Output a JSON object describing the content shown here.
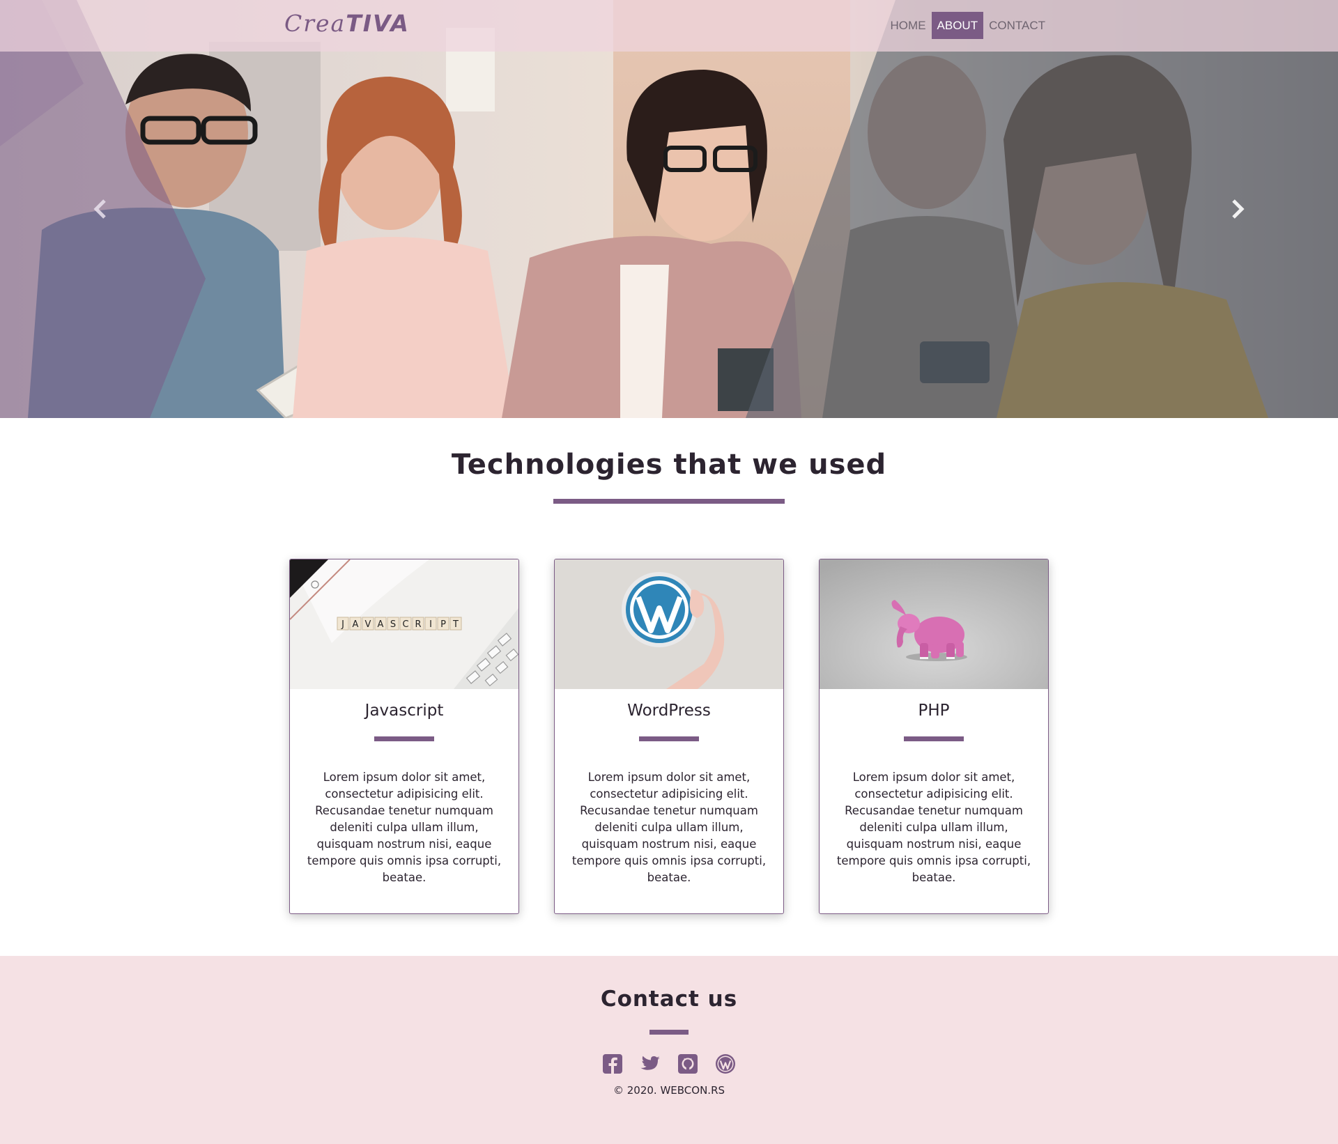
{
  "brand": {
    "logo_light": "Crea",
    "logo_bold": "TIVA"
  },
  "nav": {
    "items": [
      "HOME",
      "ABOUT",
      "CONTACT"
    ],
    "active": "ABOUT"
  },
  "hero": {
    "prev_icon": "chevron-left-icon",
    "next_icon": "chevron-right-icon"
  },
  "technologies": {
    "title": "Technologies that we used",
    "cards": [
      {
        "title": "Javascript",
        "image_text": "JAVASCRIPT",
        "text": "Lorem ipsum dolor sit amet, consectetur adipisicing elit. Recusandae tenetur numquam deleniti culpa ullam illum, quisquam nostrum nisi, eaque tempore quis omnis ipsa corrupti, beatae."
      },
      {
        "title": "WordPress",
        "text": "Lorem ipsum dolor sit amet, consectetur adipisicing elit. Recusandae tenetur numquam deleniti culpa ullam illum, quisquam nostrum nisi, eaque tempore quis omnis ipsa corrupti, beatae."
      },
      {
        "title": "PHP",
        "text": "Lorem ipsum dolor sit amet, consectetur adipisicing elit. Recusandae tenetur numquam deleniti culpa ullam illum, quisquam nostrum nisi, eaque tempore quis omnis ipsa corrupti, beatae."
      }
    ]
  },
  "contact": {
    "title": "Contact us",
    "socials": [
      "facebook-icon",
      "twitter-icon",
      "github-icon",
      "wordpress-icon"
    ],
    "copyright": "© 2020. WEBCON.RS"
  },
  "colors": {
    "accent": "#7b5b85",
    "footer_bg": "#f5e1e4",
    "navbar_bg": "#eed4de"
  }
}
